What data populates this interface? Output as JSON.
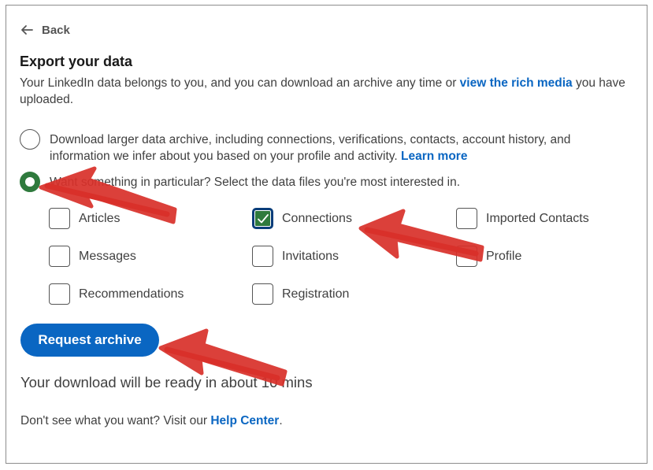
{
  "back": {
    "label": "Back"
  },
  "title": "Export your data",
  "intro": {
    "text_before": "Your LinkedIn data belongs to you, and you can download an archive any time or ",
    "link": "view the rich media",
    "text_after": " you have uploaded."
  },
  "options": {
    "larger": {
      "text": "Download larger data archive, including connections, verifications, contacts, account history, and information we infer about you based on your profile and activity. ",
      "link": "Learn more",
      "selected": false
    },
    "particular": {
      "text": "Want something in particular? Select the data files you're most interested in.",
      "selected": true
    }
  },
  "files": {
    "articles": {
      "label": "Articles",
      "checked": false
    },
    "connections": {
      "label": "Connections",
      "checked": true
    },
    "imported_contacts": {
      "label": "Imported Contacts",
      "checked": false
    },
    "messages": {
      "label": "Messages",
      "checked": false
    },
    "invitations": {
      "label": "Invitations",
      "checked": false
    },
    "profile": {
      "label": "Profile",
      "checked": false
    },
    "recommendations": {
      "label": "Recommendations",
      "checked": false
    },
    "registration": {
      "label": "Registration",
      "checked": false
    }
  },
  "request_button": "Request archive",
  "ready_text": "Your download will be ready in about 10 mins",
  "footer": {
    "text_before": "Don't see what you want? Visit our ",
    "link": "Help Center",
    "text_after": "."
  },
  "colors": {
    "accent_blue": "#0a66c2",
    "selected_green": "#2f7a3d",
    "annotation_red": "#d9302a"
  },
  "annotations": [
    "red-arrow-to-radio",
    "red-arrow-to-connections",
    "red-arrow-to-request-button"
  ]
}
